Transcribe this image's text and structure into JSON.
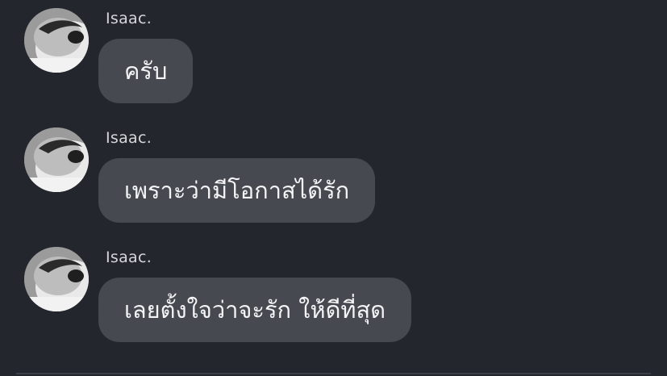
{
  "chat": {
    "messages": [
      {
        "sender": "Isaac.",
        "text": "ครับ",
        "avatar_icon": "user-avatar-photo"
      },
      {
        "sender": "Isaac.",
        "text": "เพราะว่ามีโอกาสได้รัก",
        "avatar_icon": "user-avatar-photo"
      },
      {
        "sender": "Isaac.",
        "text": "เลยตั้งใจว่าจะรัก ให้ดีที่สุด",
        "avatar_icon": "user-avatar-photo"
      }
    ]
  },
  "colors": {
    "background": "#24262d",
    "bubble": "#464950",
    "sender_text": "#d6d7db",
    "message_text": "#f4f4f6"
  }
}
